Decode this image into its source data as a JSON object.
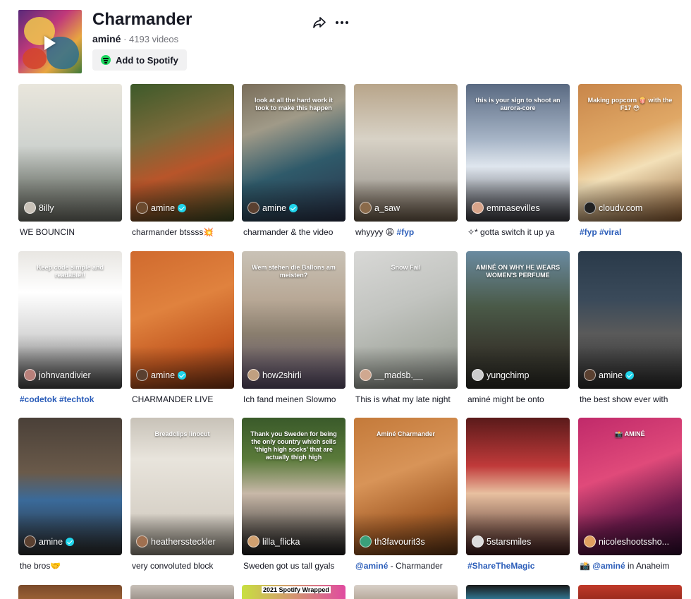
{
  "playlist": {
    "title": "Charmander",
    "author": "aminé",
    "separator": " · ",
    "video_count": "4193 videos",
    "spotify_label": "Add to Spotify"
  },
  "colors": {
    "verified": "#20d5ec",
    "hashtag": "#2b5db9",
    "spotify": "#1ed760"
  },
  "videos": [
    {
      "user": "8illy",
      "verified": false,
      "caption_tag": "",
      "caption": "WE BOUNCIN",
      "overlay": "",
      "bg": "linear-gradient(180deg,#e9e6dc 0%,#cfd3cf 45%,#8a8f88 70%,#6d6f66 100%)",
      "avatar": "#c9c2b8"
    },
    {
      "user": "amine",
      "verified": true,
      "caption_tag": "",
      "caption": "charmander btssss💥",
      "overlay": "",
      "bg": "linear-gradient(160deg,#3d5a2a 0%,#7a6a3a 35%,#b8552a 60%,#3c4a22 100%)",
      "avatar": "#6b4a2e"
    },
    {
      "user": "amine",
      "verified": true,
      "caption_tag": "",
      "caption": "charmander & the video",
      "overlay": "look at all the hard work it took to make this happen",
      "bg": "linear-gradient(160deg,#7a6e5a 0%,#a09a88 30%,#2f5a6a 60%,#2a3148 100%)",
      "avatar": "#5a4030"
    },
    {
      "user": "a_saw",
      "verified": false,
      "caption_tag": "#fyp",
      "caption": "whyyyy 😩",
      "overlay": "",
      "bg": "linear-gradient(180deg,#b8a58a 0%,#d8d2c6 40%,#b2ada4 70%,#6a5a48 100%)",
      "avatar": "#8a6a4a"
    },
    {
      "user": "emmasevilles",
      "verified": false,
      "caption_tag": "",
      "caption": "✧* gotta switch it up ya",
      "overlay": "this is your sign to shoot an aurora-core",
      "bg": "linear-gradient(180deg,#5a6a82 0%,#a6b4c6 40%,#dfe6ee 60%,#3a3a40 100%)",
      "avatar": "#d8a48a"
    },
    {
      "user": "cloudv.com",
      "verified": false,
      "caption_tag": "#fyp #viral",
      "caption": "",
      "overlay": "Making popcorn 🍿 with the F17 😳",
      "bg": "linear-gradient(160deg,#c8864a 0%,#e0a866 40%,#f3e0b8 60%,#8a5a30 100%)",
      "avatar": "#222222"
    },
    {
      "user": "johnvandivier",
      "verified": false,
      "caption_tag": "#codetok #techtok",
      "caption": "",
      "overlay": "Keep code simple and readable!!",
      "bg": "linear-gradient(180deg,#e8e6e2 0%,#ffffff 30%,#d9d9d9 60%,#444444 100%)",
      "avatar": "#b8807a"
    },
    {
      "user": "amine",
      "verified": true,
      "caption_tag": "",
      "caption": "CHARMANDER LIVE",
      "overlay": "",
      "bg": "linear-gradient(160deg,#d06a2e 0%,#e0823e 40%,#c45a22 70%,#7a3414 100%)",
      "avatar": "#5a4030"
    },
    {
      "user": "how2shirli",
      "verified": false,
      "caption_tag": "",
      "caption": "Ich fand meinen Slowmo",
      "overlay": "Wem stehen die Ballons am meisten?",
      "bg": "linear-gradient(180deg,#c9c2b6 0%,#b8a896 35%,#8a7e6e 60%,#5a4e6a 100%)",
      "avatar": "#c0a080"
    },
    {
      "user": "__madsb.__",
      "verified": false,
      "caption_tag": "",
      "caption": "This is what my late night",
      "overlay": "Snow Fail",
      "bg": "linear-gradient(160deg,#d8d8d6 0%,#c2c4c0 40%,#a8aca4 70%,#8a8e88 100%)",
      "avatar": "#d0a890"
    },
    {
      "user": "yungchimp",
      "verified": false,
      "caption_tag": "",
      "caption": "aminé might be onto",
      "overlay": "AMINÉ ON WHY HE WEARS WOMEN'S PERFUME",
      "bg": "linear-gradient(180deg,#6a8aa0 0%,#4a5a48 40%,#3a3a30 70%,#2a2a24 100%)",
      "avatar": "#cccccc"
    },
    {
      "user": "amine",
      "verified": true,
      "caption_tag": "",
      "caption": "the best show ever with",
      "overlay": "",
      "bg": "linear-gradient(180deg,#2a3a4a 0%,#3a4a5a 35%,#5a5a5a 60%,#2a2a2a 100%)",
      "avatar": "#5a4030"
    },
    {
      "user": "amine",
      "verified": true,
      "caption_tag": "",
      "caption": "the bros🤝",
      "overlay": "",
      "bg": "linear-gradient(180deg,#4a4038 0%,#6a5a4a 40%,#3a6a9a 60%,#2a2a2a 100%)",
      "avatar": "#5a4030"
    },
    {
      "user": "heatherssteckler",
      "verified": false,
      "caption_tag": "",
      "caption": "very convoluted block",
      "overlay": "Breadclips linocut",
      "bg": "linear-gradient(180deg,#c8c2b8 0%,#e8e4dc 30%,#d8d2c8 70%,#8a8478 100%)",
      "avatar": "#a07050"
    },
    {
      "user": "lilla_flicka",
      "verified": false,
      "caption_tag": "",
      "caption": "Sweden got us tall gyals",
      "overlay": "Thank you Sweden for being the only country which sells 'thigh high socks' that are actually thigh high",
      "bg": "linear-gradient(180deg,#3a5a2a 0%,#5a7a3a 30%,#c8b8a8 55%,#1a1a1a 100%)",
      "avatar": "#d0a070"
    },
    {
      "user": "th3favourit3s",
      "verified": false,
      "caption_tag": "@aminé",
      "caption": " - Charmander",
      "overlay": "Aminé Charmander",
      "bg": "linear-gradient(160deg,#c47a3a 0%,#d89458 40%,#a8602a 70%,#5a3214 100%)",
      "avatar": "#3aa07a"
    },
    {
      "user": "5starsmiles",
      "verified": false,
      "caption_tag": "#ShareTheMagic",
      "caption": "",
      "overlay": "",
      "bg": "linear-gradient(180deg,#5a1a1a 0%,#c03a3a 35%,#e8c0a0 55%,#3a1a1a 100%)",
      "avatar": "#dddddd"
    },
    {
      "user": "nicoleshootssho...",
      "verified": false,
      "caption_tag": "@aminé",
      "caption": " in Anaheim",
      "caption_prefix": "📸 ",
      "overlay": "📸 AMINÉ",
      "bg": "linear-gradient(160deg,#c02a6a 0%,#e04a7a 40%,#6a1a4a 70%,#2a0a2a 100%)",
      "avatar": "#e0a060"
    }
  ],
  "row4_label": "2021 Spotify Wrapped"
}
